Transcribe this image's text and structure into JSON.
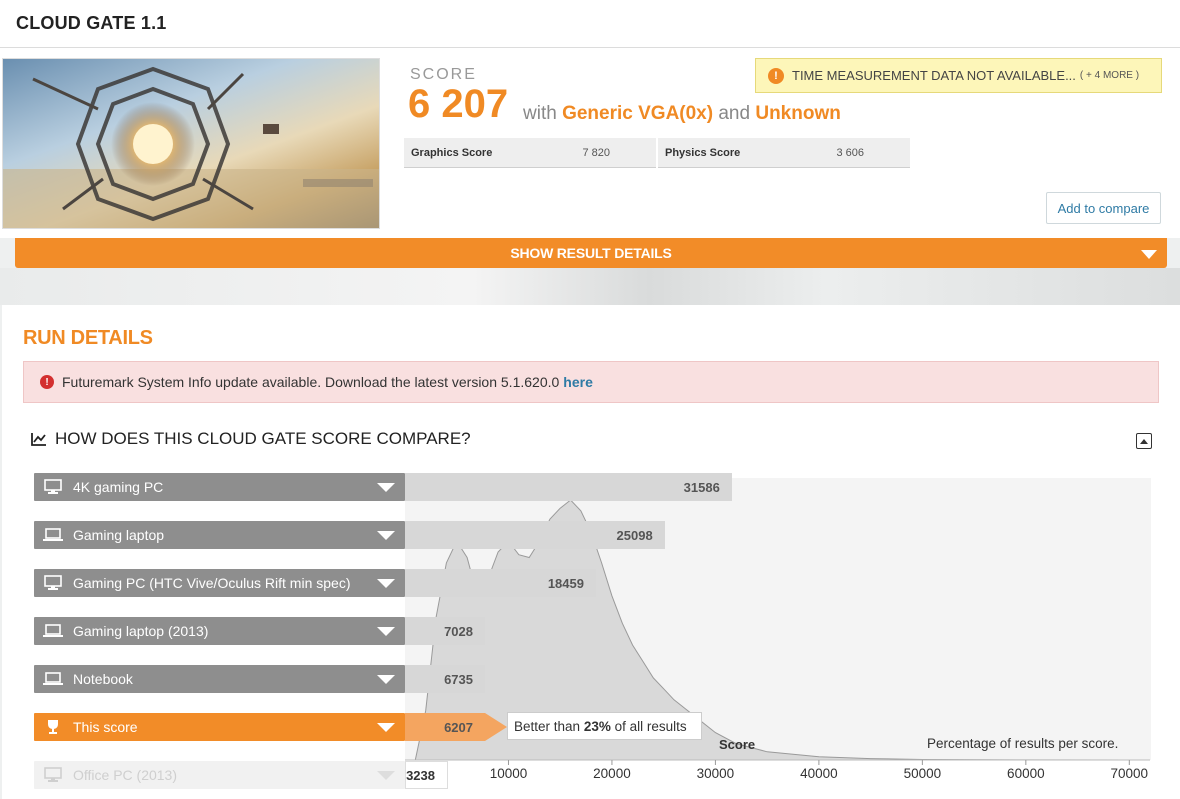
{
  "page": {
    "title": "CLOUD GATE 1.1"
  },
  "result": {
    "score_label": "SCORE",
    "score_value": "6 207",
    "with_word": "with",
    "gpu": "Generic VGA(0x)",
    "and_word": "and",
    "cpu": "Unknown",
    "sub_scores": [
      {
        "label": "Graphics Score",
        "value": "7 820"
      },
      {
        "label": "Physics Score",
        "value": "3 606"
      }
    ],
    "warning": {
      "text": "TIME MEASUREMENT DATA NOT AVAILABLE...",
      "more": "( + 4 MORE )",
      "icon": "warning-icon"
    },
    "compare_button": "Add to compare",
    "details_toggle": "SHOW RESULT DETAILS"
  },
  "run_details": {
    "title": "RUN DETAILS",
    "alert_text": "Futuremark System Info update available. Download the latest version 5.1.620.0",
    "alert_link": "here",
    "compare_heading": "HOW DOES THIS CLOUD GATE SCORE COMPARE?"
  },
  "comparison": {
    "rows": [
      {
        "label": "4K gaming PC",
        "value": "31586",
        "kind": "normal",
        "icon": "desktop-icon"
      },
      {
        "label": "Gaming laptop",
        "value": "25098",
        "kind": "normal",
        "icon": "laptop-icon"
      },
      {
        "label": "Gaming PC (HTC Vive/Oculus Rift min spec)",
        "value": "18459",
        "kind": "normal",
        "icon": "desktop-icon"
      },
      {
        "label": "Gaming laptop (2013)",
        "value": "7028",
        "kind": "normal",
        "icon": "laptop-icon"
      },
      {
        "label": "Notebook",
        "value": "6735",
        "kind": "normal",
        "icon": "laptop-icon"
      },
      {
        "label": "This score",
        "value": "6207",
        "kind": "this",
        "icon": "trophy-icon"
      },
      {
        "label": "Office PC (2013)",
        "value": "3238",
        "kind": "faded",
        "icon": "desktop-icon"
      }
    ],
    "better_prefix": "Better than",
    "better_pct": "23%",
    "better_suffix": "of all results"
  },
  "chart_data": {
    "type": "area",
    "xlabel": "Score",
    "note": "Percentage of results per score.",
    "xlim": [
      0,
      72000
    ],
    "x_ticks": [
      10000,
      20000,
      30000,
      40000,
      50000,
      60000,
      70000
    ],
    "x_tick_labels": [
      "10000",
      "20000",
      "30000",
      "40000",
      "50000",
      "60000",
      "70000"
    ],
    "distribution": {
      "x": [
        1000,
        2000,
        3000,
        4000,
        5000,
        6000,
        7000,
        8000,
        9000,
        10000,
        11000,
        12000,
        13000,
        14000,
        15000,
        16000,
        17000,
        18000,
        19000,
        20000,
        21000,
        22000,
        23000,
        24000,
        25000,
        26000,
        27000,
        28000,
        30000,
        32000,
        35000,
        40000,
        45000,
        50000,
        60000,
        70000
      ],
      "y": [
        0,
        18,
        52,
        72,
        80,
        74,
        60,
        66,
        76,
        80,
        75,
        74,
        80,
        88,
        92,
        95,
        91,
        83,
        72,
        60,
        50,
        42,
        36,
        30,
        26,
        22,
        19,
        16,
        10,
        6,
        3,
        1.2,
        0.5,
        0.2,
        0.05,
        0
      ]
    },
    "colors": {
      "this": "#f28c28",
      "bar": "#d7d7d7",
      "area": "#d9d9d9"
    }
  }
}
